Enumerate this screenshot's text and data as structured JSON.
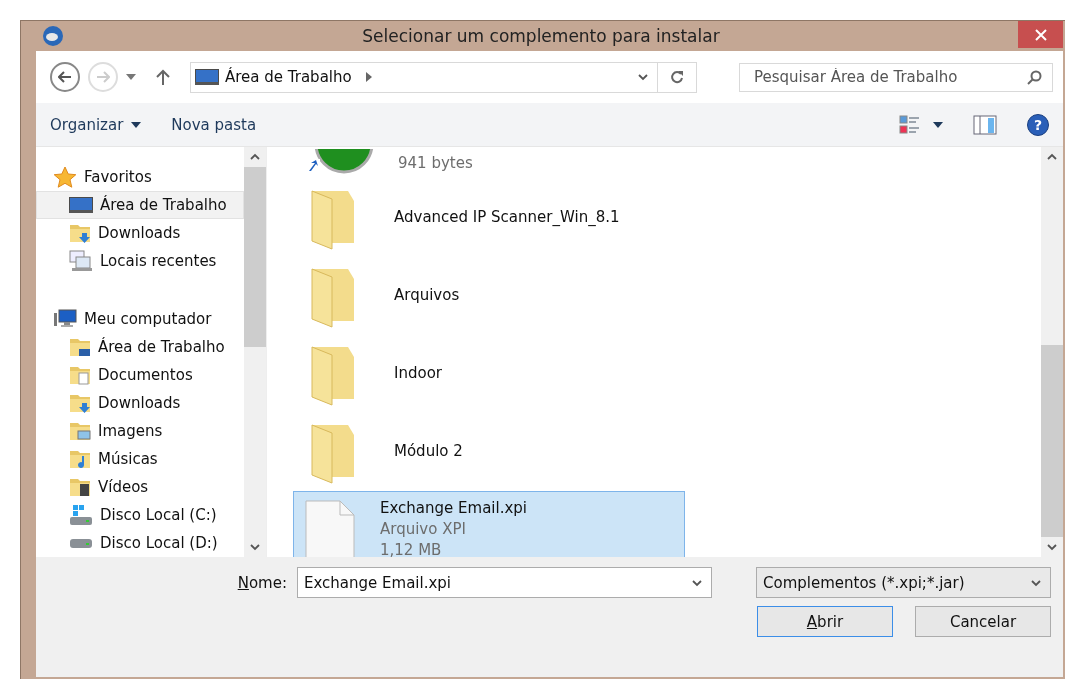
{
  "window": {
    "title": "Selecionar um complemento para instalar"
  },
  "address_bar": {
    "location": "Área de Trabalho"
  },
  "search": {
    "placeholder": "Pesquisar Área de Trabalho"
  },
  "toolbar": {
    "help_symbol": "?",
    "items": [
      {
        "label": "Organizar",
        "kind": "menu"
      },
      {
        "label": "Nova pasta",
        "kind": "button"
      }
    ]
  },
  "nav_pane": {
    "groups": [
      {
        "label": "Favoritos",
        "kind": "star",
        "children": [
          {
            "label": "Área de Trabalho",
            "kind": "desktop",
            "selected": true
          },
          {
            "label": "Downloads",
            "kind": "downloads",
            "selected": false
          },
          {
            "label": "Locais recentes",
            "kind": "recent",
            "selected": false
          }
        ]
      },
      {
        "label": "Meu computador",
        "kind": "computer",
        "children": [
          {
            "label": "Área de Trabalho",
            "kind": "desktop-folder",
            "selected": false
          },
          {
            "label": "Documentos",
            "kind": "documents",
            "selected": false
          },
          {
            "label": "Downloads",
            "kind": "downloads",
            "selected": false
          },
          {
            "label": "Imagens",
            "kind": "pictures",
            "selected": false
          },
          {
            "label": "Músicas",
            "kind": "music",
            "selected": false
          },
          {
            "label": "Vídeos",
            "kind": "videos",
            "selected": false
          },
          {
            "label": "Disco Local (C:)",
            "kind": "drive-system",
            "selected": false
          },
          {
            "label": "Disco Local (D:)",
            "kind": "drive",
            "selected": false
          }
        ]
      }
    ]
  },
  "files": [
    {
      "kind": "shortcut",
      "details": [
        "941 bytes"
      ],
      "selected": false
    },
    {
      "kind": "folder",
      "name": "Advanced IP Scanner_Win_8.1",
      "selected": false
    },
    {
      "kind": "folder",
      "name": "Arquivos",
      "selected": false
    },
    {
      "kind": "folder",
      "name": "Indoor",
      "selected": false
    },
    {
      "kind": "folder",
      "name": "Módulo 2",
      "selected": false
    },
    {
      "kind": "file",
      "name": "Exchange Email.xpi",
      "details": [
        "Arquivo XPI",
        "1,12 MB"
      ],
      "selected": true
    }
  ],
  "footer": {
    "name_label": {
      "text": "Nome:",
      "underline_first": true
    },
    "name_value": "Exchange Email.xpi",
    "filter": "Complementos (*.xpi;*.jar)",
    "buttons": [
      {
        "label": "Abrir",
        "underline_first": true,
        "default": true
      },
      {
        "label": "Cancelar",
        "underline_first": false,
        "default": false
      }
    ]
  }
}
